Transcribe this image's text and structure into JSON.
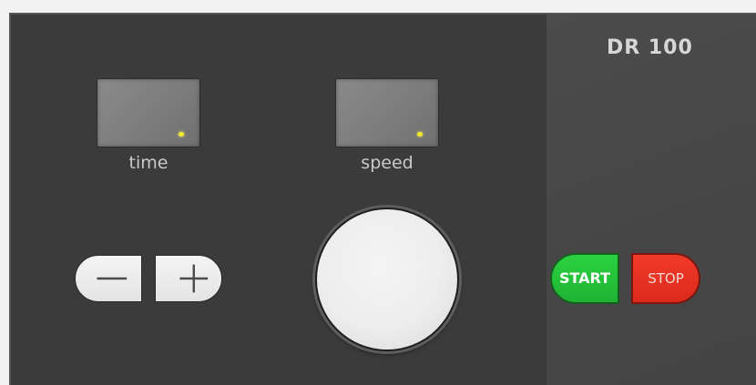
{
  "device": {
    "model": "DR 100"
  },
  "displays": {
    "time": {
      "label": "time"
    },
    "speed": {
      "label": "speed"
    }
  },
  "controls": {
    "minus_icon": "minus-icon",
    "plus_icon": "plus-icon",
    "start_label": "START",
    "stop_label": "STOP"
  },
  "colors": {
    "panel": "#3b3b3b",
    "start": "#22c138",
    "stop": "#e6301f",
    "indicator": "#f4ea2d"
  }
}
